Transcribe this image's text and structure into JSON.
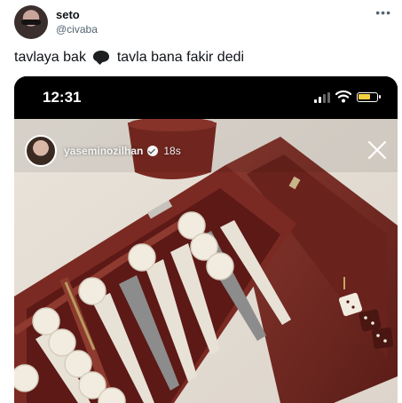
{
  "tweet": {
    "display_name": "seto",
    "handle": "@civaba",
    "text_before": "tavlaya bak",
    "text_after": "tavla bana fakir dedi",
    "emoji_icon": "speech-bubble-icon"
  },
  "media": {
    "status_bar": {
      "time": "12:31",
      "battery_color": "#f4d03f"
    },
    "story": {
      "username": "yaseminozilhan",
      "time": "18s"
    },
    "colors": {
      "board_case": "#7a2a22",
      "board_felt": "#5e1a17",
      "checker": "#f2ece0",
      "background_fabric": "#e6e0d8"
    }
  }
}
